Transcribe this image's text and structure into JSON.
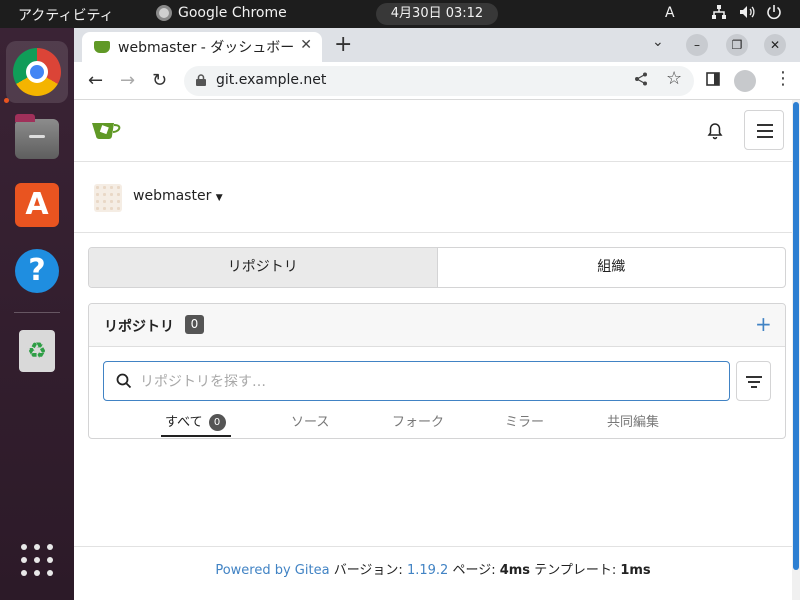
{
  "topbar": {
    "activities": "アクティビティ",
    "app_name": "Google Chrome",
    "clock": "4月30日  03:12",
    "input_method": "A"
  },
  "browser": {
    "tab_title": "webmaster - ダッシュボード",
    "url": "git.example.net"
  },
  "gitea": {
    "context_user": "webmaster",
    "switch": [
      "リポジトリ",
      "組織"
    ],
    "repo_panel": {
      "title": "リポジトリ",
      "count": "0",
      "search_placeholder": "リポジトリを探す…",
      "tabs": [
        {
          "label": "すべて",
          "count": "0"
        },
        {
          "label": "ソース"
        },
        {
          "label": "フォーク"
        },
        {
          "label": "ミラー"
        },
        {
          "label": "共同編集"
        }
      ]
    },
    "footer": {
      "powered_by": "Powered by Gitea",
      "version_label": "バージョン:",
      "version": "1.19.2",
      "page_label": "ページ:",
      "page_time": "4ms",
      "template_label": "テンプレート:",
      "template_time": "1ms"
    }
  },
  "colors": {
    "gitea_green": "#609926",
    "link_blue": "#4183c4",
    "ubuntu_orange": "#e95420"
  }
}
